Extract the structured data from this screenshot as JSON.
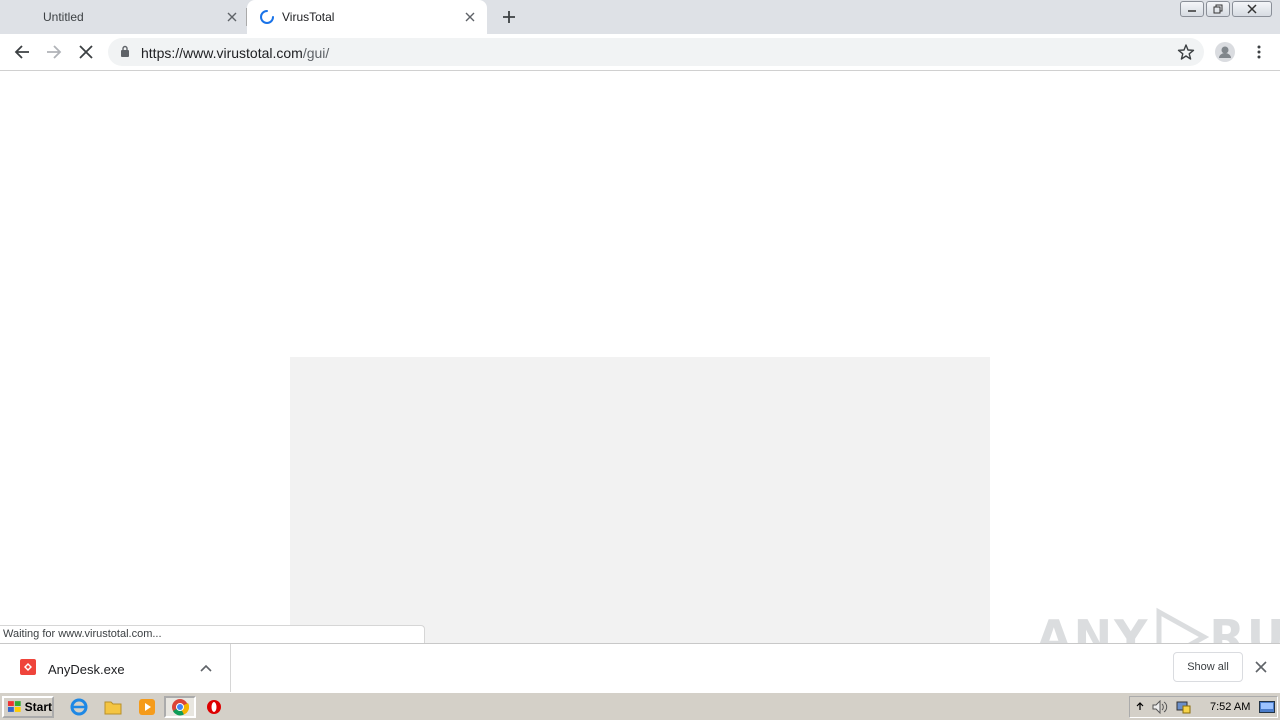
{
  "tabs": [
    {
      "title": "Untitled",
      "active": false
    },
    {
      "title": "VirusTotal",
      "active": true
    }
  ],
  "address_bar": {
    "url_host": "https://www.virustotal.com",
    "url_path": "/gui/"
  },
  "status_text": "Waiting for www.virustotal.com...",
  "download_shelf": {
    "file_name": "AnyDesk.exe",
    "show_all_label": "Show all"
  },
  "watermark": {
    "text_left": "ANY",
    "text_right": "RUN"
  },
  "taskbar": {
    "start_label": "Start",
    "clock": "7:52 AM"
  },
  "colors": {
    "tabstrip": "#dee1e6",
    "omnibox": "#f1f3f4",
    "loading_panel": "#f2f2f2",
    "anydesk_red": "#ef443b",
    "spinner_blue": "#1a73e8"
  }
}
